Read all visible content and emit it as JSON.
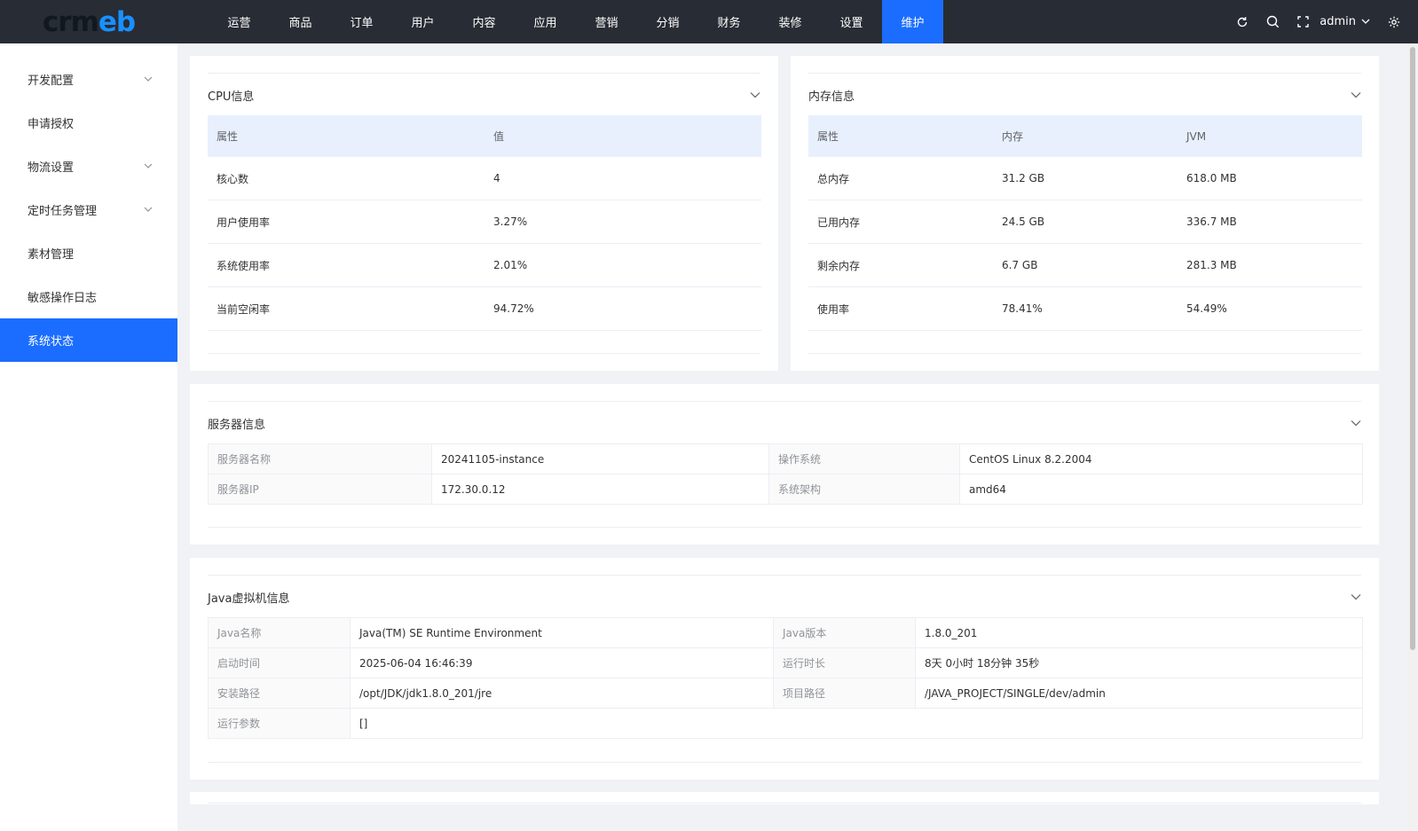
{
  "brand": {
    "logo_text_a": "crm",
    "logo_text_b": "eb"
  },
  "topnav": [
    {
      "label": "运营"
    },
    {
      "label": "商品"
    },
    {
      "label": "订单"
    },
    {
      "label": "用户"
    },
    {
      "label": "内容"
    },
    {
      "label": "应用"
    },
    {
      "label": "营销"
    },
    {
      "label": "分销"
    },
    {
      "label": "财务"
    },
    {
      "label": "装修"
    },
    {
      "label": "设置"
    },
    {
      "label": "维护",
      "active": true
    }
  ],
  "user": {
    "name": "admin"
  },
  "sidebar": [
    {
      "label": "开发配置",
      "has_children": true
    },
    {
      "label": "申请授权",
      "has_children": false
    },
    {
      "label": "物流设置",
      "has_children": true
    },
    {
      "label": "定时任务管理",
      "has_children": true
    },
    {
      "label": "素材管理",
      "has_children": false
    },
    {
      "label": "敏感操作日志",
      "has_children": false
    },
    {
      "label": "系统状态",
      "has_children": false,
      "active": true
    }
  ],
  "cpu": {
    "title": "CPU信息",
    "columns": [
      "属性",
      "值"
    ],
    "rows": [
      [
        "核心数",
        "4"
      ],
      [
        "用户使用率",
        "3.27%"
      ],
      [
        "系统使用率",
        "2.01%"
      ],
      [
        "当前空闲率",
        "94.72%"
      ]
    ]
  },
  "memory": {
    "title": "内存信息",
    "columns": [
      "属性",
      "内存",
      "JVM"
    ],
    "rows": [
      [
        "总内存",
        "31.2 GB",
        "618.0 MB"
      ],
      [
        "已用内存",
        "24.5 GB",
        "336.7 MB"
      ],
      [
        "剩余内存",
        "6.7 GB",
        "281.3 MB"
      ],
      [
        "使用率",
        "78.41%",
        "54.49%"
      ]
    ]
  },
  "server": {
    "title": "服务器信息",
    "rows": [
      [
        "服务器名称",
        "20241105-instance",
        "操作系统",
        "CentOS Linux 8.2.2004"
      ],
      [
        "服务器IP",
        "172.30.0.12",
        "系统架构",
        "amd64"
      ]
    ]
  },
  "jvm": {
    "title": "Java虚拟机信息",
    "rows": [
      [
        "Java名称",
        "Java(TM) SE Runtime Environment",
        "Java版本",
        "1.8.0_201"
      ],
      [
        "启动时间",
        "2025-06-04 16:46:39",
        "运行时长",
        "8天 0小时 18分钟 35秒"
      ],
      [
        "安装路径",
        "/opt/JDK/jdk1.8.0_201/jre",
        "项目路径",
        "/JAVA_PROJECT/SINGLE/dev/admin"
      ]
    ],
    "args_label": "运行参数",
    "args_value": "[]"
  },
  "colors": {
    "topbar": "#282c34",
    "accent": "#1a6dff",
    "header_row": "#e8f0fe"
  }
}
